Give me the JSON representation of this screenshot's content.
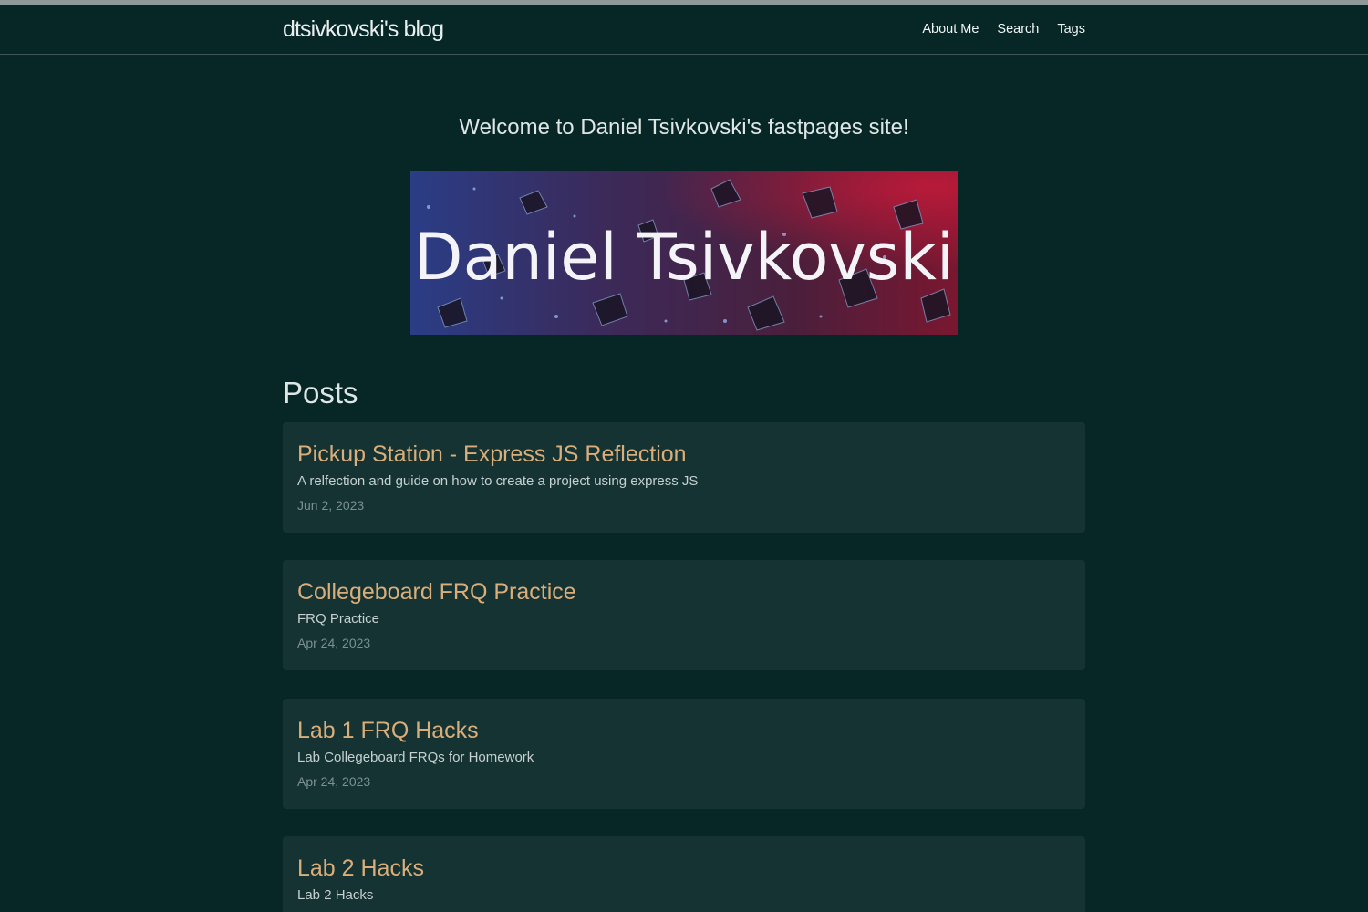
{
  "site": {
    "title": "dtsivkovski's blog"
  },
  "nav": {
    "items": [
      "About Me",
      "Search",
      "Tags"
    ]
  },
  "welcome": "Welcome to Daniel Tsivkovski's fastpages site!",
  "banner": {
    "text": "Daniel Tsivkovski"
  },
  "posts_heading": "Posts",
  "posts": [
    {
      "title": "Pickup Station - Express JS Reflection",
      "description": "A relfection and guide on how to create a project using express JS",
      "date": "Jun 2, 2023"
    },
    {
      "title": "Collegeboard FRQ Practice",
      "description": "FRQ Practice",
      "date": "Apr 24, 2023"
    },
    {
      "title": "Lab 1 FRQ Hacks",
      "description": "Lab Collegeboard FRQs for Homework",
      "date": "Apr 24, 2023"
    },
    {
      "title": "Lab 2 Hacks",
      "description": "Lab 2 Hacks",
      "date": ""
    }
  ],
  "colors": {
    "background": "#072727",
    "card": "#153333",
    "post_title": "#d9ae7a",
    "text": "#dfe6e6"
  }
}
